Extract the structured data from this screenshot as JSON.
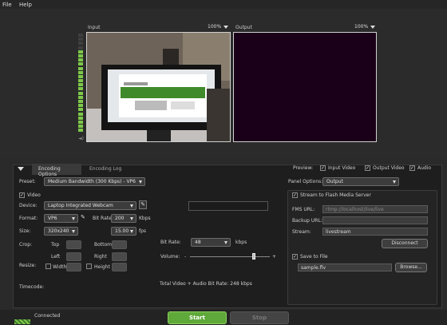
{
  "menu": {
    "file": "File",
    "help": "Help"
  },
  "input_panel": {
    "title": "Input",
    "zoom": "100%"
  },
  "output_panel": {
    "title": "Output",
    "zoom": "100%"
  },
  "tabs": {
    "encoding_options": "Encoding Options",
    "encoding_log": "Encoding Log"
  },
  "preview": {
    "label": "Preview:",
    "input_video": "Input Video",
    "output_video": "Output Video",
    "audio": "Audio"
  },
  "preset": {
    "label": "Preset:",
    "value": "Medium Bandwidth (300 Kbps) - VP6"
  },
  "video": {
    "label": "Video",
    "device_label": "Device:",
    "device_value": "Laptop Integrated Webcam",
    "format_label": "Format:",
    "format_value": "VP6",
    "bitrate_label": "Bit Rate",
    "bitrate_value": "200",
    "bitrate_unit": "Kbps",
    "size_label": "Size:",
    "size_value": "320x240",
    "fps_value": "15.00",
    "fps_unit": "fps",
    "crop_label": "Crop:",
    "top": "Top",
    "bottom": "Bottom",
    "left": "Left",
    "right": "Right",
    "resize_label": "Resize:",
    "width": "Width",
    "height": "Height"
  },
  "audio": {
    "bitrate_label": "Bit Rate:",
    "bitrate_value": "48",
    "bitrate_unit": "kbps",
    "volume_label": "Volume:",
    "minus": "-",
    "plus": "+",
    "volume_level": 0.8
  },
  "timecode_label": "Timecode:",
  "total_bitrate": "Total Video + Audio Bit Rate: 248 kbps",
  "panel_options": {
    "label": "Panel Options:",
    "value": "Output"
  },
  "stream": {
    "label": "Stream to Flash Media Server",
    "fms_label": "FMS URL:",
    "fms_value": "rtmp://localhost/live/live",
    "backup_label": "Backup URL:",
    "backup_value": "",
    "stream_label": "Stream:",
    "stream_value": "livestream",
    "disconnect": "Disconnect"
  },
  "save": {
    "label": "Save to File",
    "file_value": "sample.flv",
    "browse": "Browse..."
  },
  "status": {
    "text": "Connected"
  },
  "buttons": {
    "start": "Start",
    "stop": "Stop"
  },
  "colors": {
    "start_green": "#5fa83a",
    "screen_green": "#3f8a2a",
    "output_bg": "#1a0018"
  }
}
